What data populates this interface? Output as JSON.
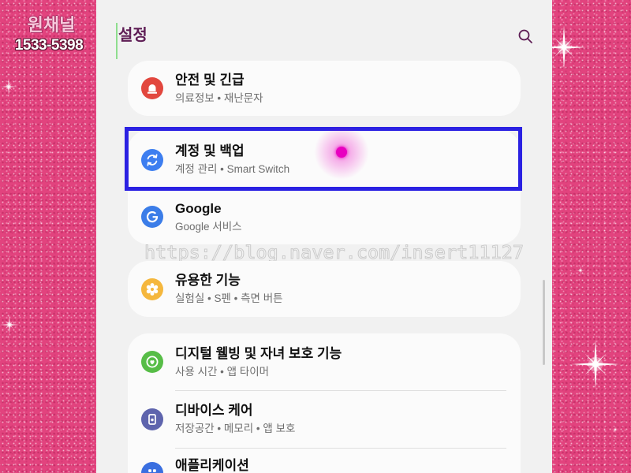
{
  "overlay": {
    "channel_name": "원채널",
    "phone_number": "1533-5398",
    "watermark_url": "https://blog.naver.com/insert11127",
    "sparkle_icon": "sparkle-icon"
  },
  "header": {
    "title": "설정",
    "search_icon": "search-icon",
    "title_color": "#5e1d55"
  },
  "settings_groups": [
    {
      "items": [
        {
          "title": "안전 및 긴급",
          "subtitle": "의료정보 • 재난문자",
          "icon": "siren-icon",
          "icon_color": "#e2473e"
        }
      ]
    },
    {
      "items": [
        {
          "title": "계정 및 백업",
          "subtitle": "계정 관리 • Smart Switch",
          "icon": "sync-icon",
          "icon_color": "#3d7ef0",
          "highlighted": true
        },
        {
          "title": "Google",
          "subtitle": "Google 서비스",
          "icon": "google-icon",
          "icon_color": "#3b7de8"
        }
      ]
    },
    {
      "items": [
        {
          "title": "유용한 기능",
          "subtitle": "실험실 • S펜 • 측면 버튼",
          "icon": "gear-icon",
          "icon_color": "#f5b73d"
        }
      ]
    },
    {
      "items": [
        {
          "title": "디지털 웰빙 및 자녀 보호 기능",
          "subtitle": "사용 시간 • 앱 타이머",
          "icon": "heart-circle-icon",
          "icon_color": "#57bd47"
        },
        {
          "title": "디바이스 케어",
          "subtitle": "저장공간 • 메모리 • 앱 보호",
          "icon": "device-care-icon",
          "icon_color": "#5e64ad"
        },
        {
          "title": "애플리케이션",
          "icon": "apps-icon",
          "icon_color": "#3a6fe0"
        }
      ]
    }
  ],
  "annotation": {
    "highlight_color": "#2b21e2",
    "touch_color": "#e800c0"
  },
  "colors": {
    "background_pink": "#e2437e",
    "screen_bg": "#f1f1f1",
    "card_bg": "#fbfbfb",
    "title_text": "#111111",
    "subtitle_text": "#6e6e6e",
    "focus_bar": "#8fde8f"
  }
}
